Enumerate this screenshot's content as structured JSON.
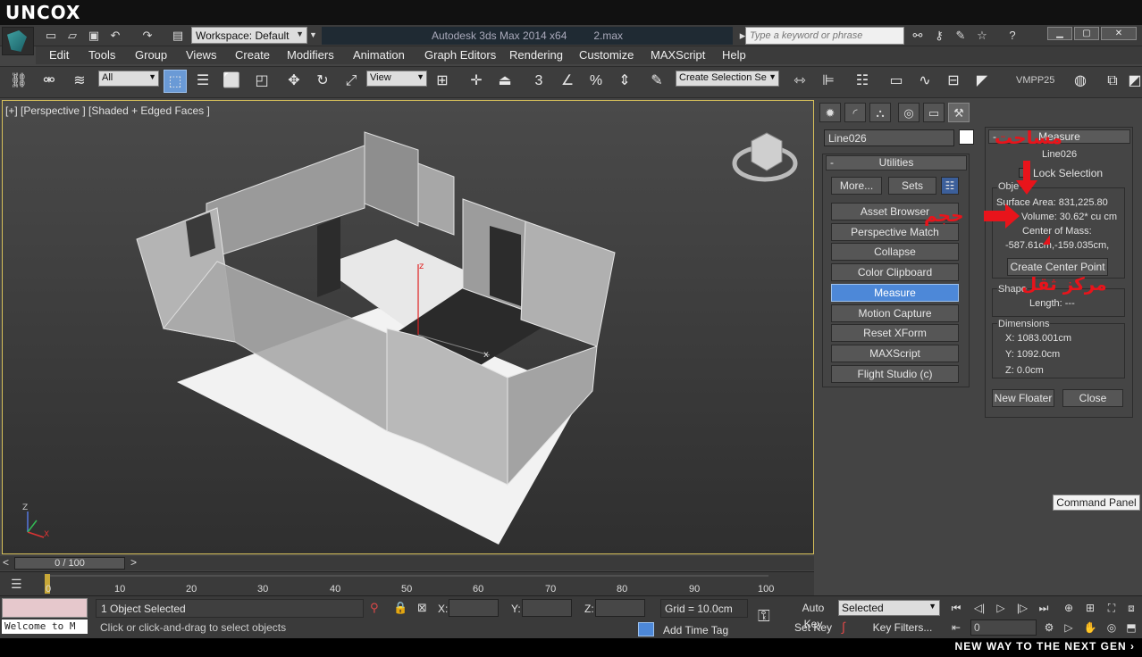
{
  "brand": "UNCOX",
  "title_bar": {
    "workspace": "Workspace: Default",
    "app_title": "Autodesk 3ds Max  2014 x64",
    "file_name": "2.max",
    "search_placeholder": "Type a keyword or phrase",
    "help": "?"
  },
  "menu": [
    "Edit",
    "Tools",
    "Group",
    "Views",
    "Create",
    "Modifiers",
    "Animation",
    "Graph Editors",
    "Rendering",
    "Customize",
    "MAXScript",
    "Help"
  ],
  "toolbar": {
    "selection_filter": "All",
    "ref_coord": "View",
    "named_selection": "Create Selection Se",
    "snap_3": "3",
    "vmpp": "VMPP25"
  },
  "viewport": {
    "label": "[+] [Perspective ] [Shaded + Edged Faces ]",
    "axis_z": "z",
    "axis_x": "x",
    "gizmo_z": "Z",
    "gizmo_x": "X"
  },
  "timeline": {
    "frame_display": "0 / 100",
    "ticks": [
      "0",
      "10",
      "20",
      "30",
      "40",
      "50",
      "60",
      "70",
      "80",
      "90",
      "100"
    ]
  },
  "status": {
    "selection": "1 Object Selected",
    "prompt": "Click or click-and-drag to select objects",
    "welcome": "Welcome to M",
    "x_label": "X:",
    "y_label": "Y:",
    "z_label": "Z:",
    "grid": "Grid = 10.0cm",
    "add_time_tag": "Add Time Tag",
    "auto_key": "Auto Key",
    "set_key": "Set Key",
    "key_mode": "Selected",
    "key_filters": "Key Filters...",
    "current_frame": "0"
  },
  "command_panel": {
    "object_name": "Line026",
    "rollout_title": "Utilities",
    "rollout_toggle": "-",
    "more": "More...",
    "sets": "Sets",
    "utilities": [
      "Asset Browser",
      "Perspective Match",
      "Collapse",
      "Color Clipboard",
      "Measure",
      "Motion Capture",
      "Reset XForm",
      "MAXScript",
      "Flight Studio (c)"
    ],
    "active_utility": "Measure",
    "tooltip": "Command Panel"
  },
  "measure": {
    "title": "Measure",
    "toggle": "-",
    "object_name": "Line026",
    "lock_selection": "Lock Selection",
    "objects_group": "Obje",
    "surface_area": "Surface Area: 831,225.80",
    "volume": "Volume: 30.62* cu cm",
    "center_of_mass": "Center of Mass:",
    "center_values": "-587.61cm,-159.035cm,",
    "create_center_point": "Create Center Point",
    "shapes_group": "Shape",
    "length": "Length: ---",
    "dimensions_group": "Dimensions",
    "dim_x": "X:  1083.001cm",
    "dim_y": "Y:  1092.0cm",
    "dim_z": "Z:  0.0cm",
    "new_floater": "New Floater",
    "close": "Close"
  },
  "annotations": {
    "area": "مساحت",
    "volume": "حجم",
    "center_of_mass": "مرکز ثقل"
  },
  "footer": {
    "tagline": "NEW WAY TO THE NEXT GEN ›"
  },
  "colors": {
    "viewport_border": "#d8c15a",
    "selected_button": "#4d88d8",
    "annotation_red": "#e8141b",
    "max_script_mini": "#e6c8cc"
  }
}
